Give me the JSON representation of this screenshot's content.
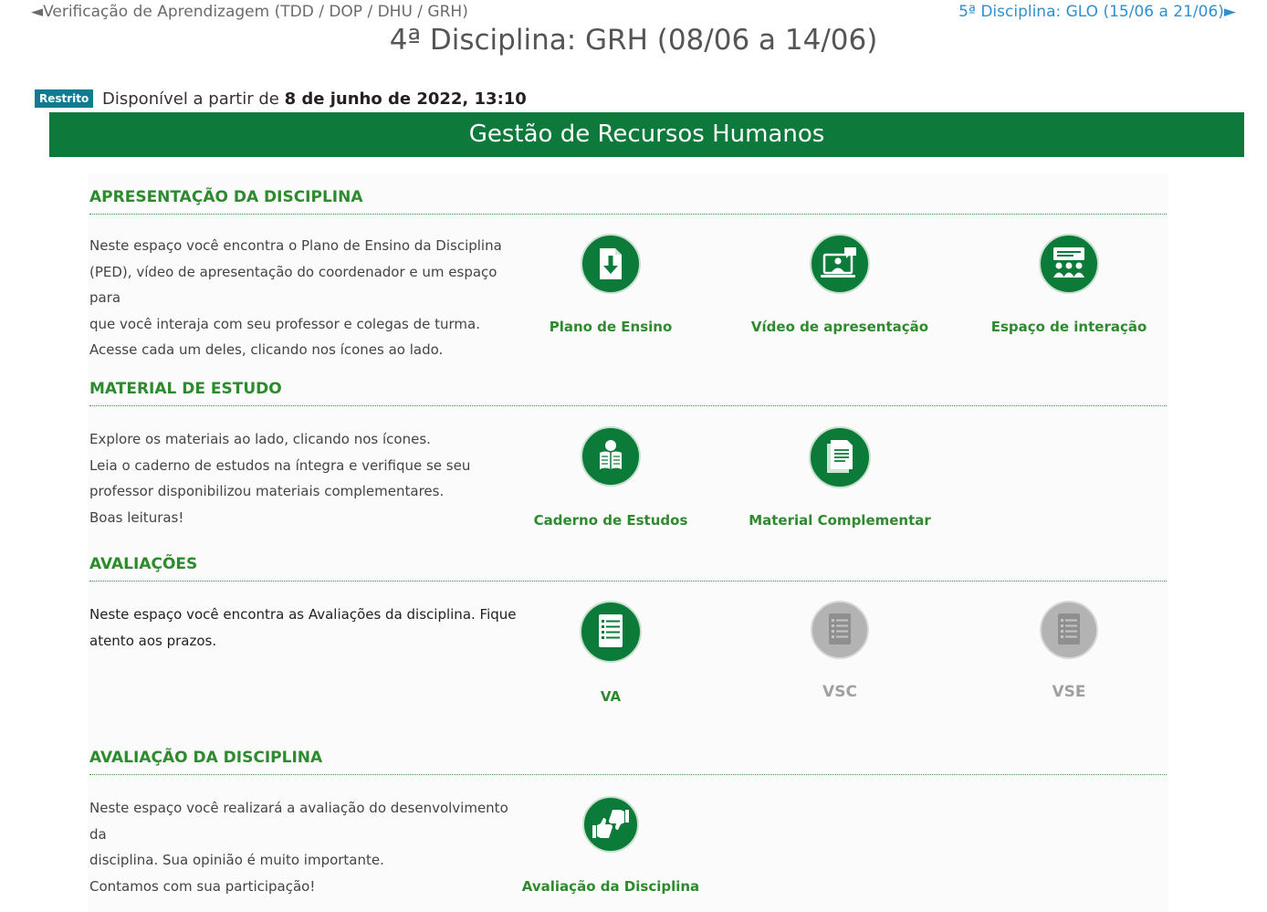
{
  "nav": {
    "prev_arrow": "◄",
    "prev_label": "Verificação de Aprendizagem (TDD / DOP / DHU / GRH)",
    "next_label": "5ª Disciplina: GLO (15/06 a 21/06)",
    "next_arrow": "►"
  },
  "page_title": "4ª Disciplina: GRH (08/06 a 14/06)",
  "restriction": {
    "badge": "Restrito",
    "prefix": "Disponível a partir de",
    "date": "8 de junho de 2022, 13:10"
  },
  "banner_title": "Gestão de Recursos Humanos",
  "colors": {
    "brand_green": "#0d7a3b",
    "section_green": "#2e8a2e",
    "link_blue": "#2f8fd0",
    "badge_teal": "#0f7c91",
    "disabled_gray": "#b3b3b3"
  },
  "sections": {
    "apresentacao": {
      "title": "APRESENTAÇÃO DA DISCIPLINA",
      "lines": [
        "Neste espaço você encontra o Plano de Ensino da Disciplina",
        "(PED), vídeo de apresentação do coordenador e um espaço para",
        "que você interaja com seu professor e colegas de turma.",
        "Acesse cada um deles, clicando nos ícones ao lado."
      ],
      "items": [
        {
          "label": "Plano de Ensino",
          "icon": "download-document-icon"
        },
        {
          "label": "Vídeo de apresentação",
          "icon": "video-presentation-icon"
        },
        {
          "label": "Espaço de interação",
          "icon": "group-interaction-icon"
        }
      ]
    },
    "material": {
      "title": "MATERIAL DE ESTUDO",
      "lines": [
        "Explore os materiais ao lado, clicando nos ícones.",
        "Leia o caderno de estudos na íntegra e verifique se seu",
        "professor disponibilizou materiais complementares.",
        "Boas leituras!"
      ],
      "items": [
        {
          "label": "Caderno de Estudos",
          "icon": "reader-book-icon"
        },
        {
          "label": "Material Complementar",
          "icon": "documents-icon"
        }
      ]
    },
    "avaliacoes": {
      "title": "AVALIAÇÕES",
      "lines": [
        "Neste espaço você encontra as Avaliações da disciplina. Fique",
        "atento aos prazos."
      ],
      "items": [
        {
          "label": "VA",
          "icon": "checklist-icon",
          "enabled": true
        },
        {
          "label": "VSC",
          "icon": "checklist-icon",
          "enabled": false
        },
        {
          "label": "VSE",
          "icon": "checklist-icon",
          "enabled": false
        }
      ]
    },
    "avaliacao_disciplina": {
      "title": "AVALIAÇÃO DA DISCIPLINA",
      "lines": [
        "Neste espaço você realizará a avaliação do desenvolvimento da",
        "disciplina. Sua opinião é muito importante.",
        "Contamos com sua participação!"
      ],
      "items": [
        {
          "label": "Avaliação da Disciplina",
          "icon": "thumbs-up-down-icon"
        }
      ]
    }
  }
}
